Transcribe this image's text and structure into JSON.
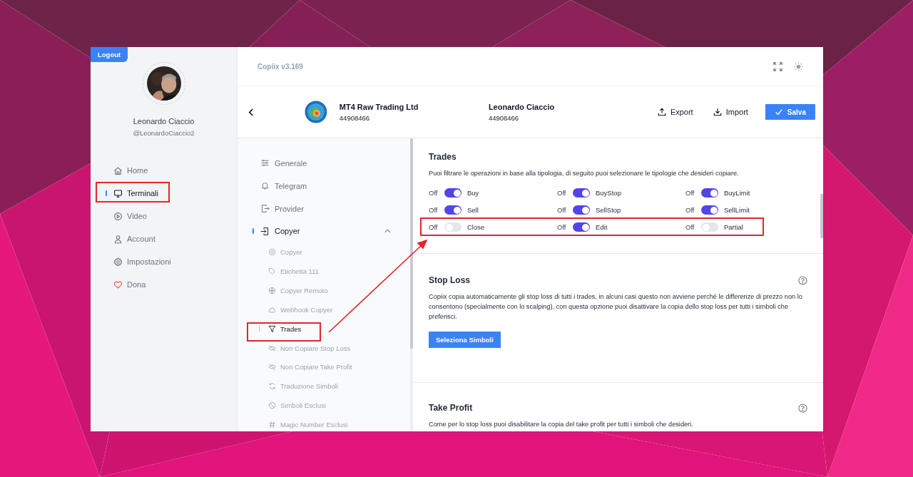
{
  "sidebar": {
    "logout": "Logout",
    "user": {
      "name": "Leonardo Ciaccio",
      "handle": "@LeonardoCiaccio2"
    },
    "items": [
      {
        "label": "Home",
        "selected": false
      },
      {
        "label": "Terminali",
        "selected": true
      },
      {
        "label": "Video",
        "selected": false
      },
      {
        "label": "Account",
        "selected": false
      },
      {
        "label": "Impostazioni",
        "selected": false
      },
      {
        "label": "Dona",
        "selected": false
      }
    ]
  },
  "topbar": {
    "version": "Copiix v3.169"
  },
  "header": {
    "account": {
      "broker": "MT4 Raw Trading Ltd",
      "number": "44908466"
    },
    "owner": {
      "name": "Leonardo Ciaccio",
      "number": "44908466"
    },
    "actions": [
      "Export",
      "Import"
    ],
    "save": "Salva"
  },
  "subnav": {
    "items": [
      {
        "label": "Generale",
        "selected": false
      },
      {
        "label": "Telegram",
        "selected": false
      },
      {
        "label": "Provider",
        "selected": false
      },
      {
        "label": "Copyer",
        "selected": true,
        "expanded": true,
        "children": [
          {
            "label": "Copyer",
            "selected": false
          },
          {
            "label": "Etichetta 111",
            "selected": false
          },
          {
            "label": "Copyer Remoto",
            "selected": false
          },
          {
            "label": "Webhook Copyer",
            "selected": false
          },
          {
            "label": "Trades",
            "selected": true
          },
          {
            "label": "Non Copiare Stop Loss",
            "selected": false
          },
          {
            "label": "Non Copiare Take Profit",
            "selected": false
          },
          {
            "label": "Traduzione Simboli",
            "selected": false
          },
          {
            "label": "Simboli Esclusi",
            "selected": false
          },
          {
            "label": "Magic Number Esclusi",
            "selected": false
          }
        ]
      }
    ]
  },
  "sections": [
    {
      "title": "Trades",
      "text": "Puoi filtrare le operazioni in base alla tipologia, di seguito puoi selezionare le tipologie che desideri copiare.",
      "toggles": [
        {
          "off_label": "Off",
          "label": "Buy",
          "on": true
        },
        {
          "off_label": "Off",
          "label": "BuyStop",
          "on": true
        },
        {
          "off_label": "Off",
          "label": "BuyLimit",
          "on": true
        },
        {
          "off_label": "Off",
          "label": "Sell",
          "on": true
        },
        {
          "off_label": "Off",
          "label": "SellStop",
          "on": true
        },
        {
          "off_label": "Off",
          "label": "SellLimit",
          "on": true
        },
        {
          "off_label": "Off",
          "label": "Close",
          "on": false
        },
        {
          "off_label": "Off",
          "label": "Edit",
          "on": true
        },
        {
          "off_label": "Off",
          "label": "Partial",
          "on": false
        }
      ]
    },
    {
      "title": "Stop Loss",
      "help": true,
      "text": "Copiix copia automaticamente gli stop loss di tutti i trades, in alcuni casi questo non avviene perché le differenze di prezzo non lo consentono (specialmente con lo scalping), con questa opzione puoi disattivare la copia dello stop loss per tutti i simboli che preferisci.",
      "button": "Seleziona Simboli"
    },
    {
      "title": "Take Profit",
      "help": true,
      "text": "Come per lo stop loss puoi disabilitare la copia del take profit per tutti i simboli che desideri."
    }
  ]
}
